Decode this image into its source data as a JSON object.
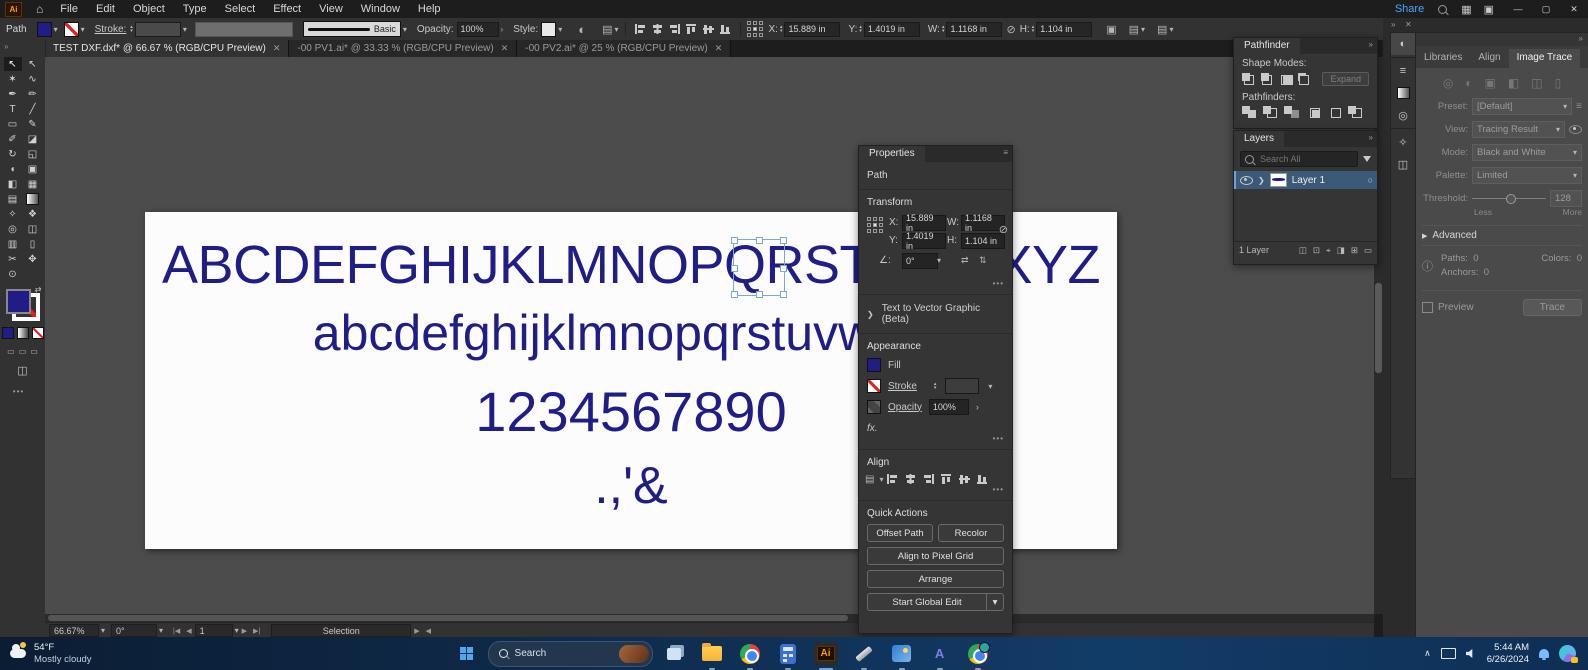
{
  "titlebar": {
    "app_label": "Ai",
    "menus": [
      "File",
      "Edit",
      "Object",
      "Type",
      "Select",
      "Effect",
      "View",
      "Window",
      "Help"
    ],
    "share_label": "Share"
  },
  "control_bar": {
    "selection_type": "Path",
    "stroke_label": "Stroke:",
    "brush_label": "Basic",
    "opacity_label": "Opacity:",
    "opacity_value": "100%",
    "style_label": "Style:",
    "x_label": "X:",
    "x_value": "15.889 in",
    "y_label": "Y:",
    "y_value": "1.4019 in",
    "w_label": "W:",
    "w_value": "1.1168 in",
    "h_label": "H:",
    "h_value": "1.104 in"
  },
  "tabs": [
    {
      "label": "TEST DXF.dxf* @ 66.67 % (RGB/CPU Preview)"
    },
    {
      "label": "-00 PV1.ai* @ 33.33 % (RGB/CPU Preview)"
    },
    {
      "label": "-00 PV2.ai* @ 25 % (RGB/CPU Preview)"
    }
  ],
  "canvas": {
    "line_uppercase": "ABCDEFGHIJKLMNOPQRSTUVWXYZ",
    "line_lowercase": "abcdefghijklmnopqrstuvwxyz",
    "line_numbers": "1234567890",
    "line_symbols": ".,'&",
    "text_color": "#201d86"
  },
  "properties": {
    "tab": "Properties",
    "object_type": "Path",
    "transform": {
      "title": "Transform",
      "x_label": "X:",
      "x_value": "15.889 in",
      "y_label": "Y:",
      "y_value": "1.4019 in",
      "w_label": "W:",
      "w_value": "1.1168 in",
      "h_label": "H:",
      "h_value": "1.104 in",
      "angle_value": "0°"
    },
    "ttvg_label": "Text to Vector Graphic (Beta)",
    "appearance": {
      "title": "Appearance",
      "fill_label": "Fill",
      "stroke_label": "Stroke",
      "opacity_label": "Opacity",
      "opacity_value": "100%",
      "fx_label": "fx."
    },
    "align_title": "Align",
    "quick_actions": {
      "title": "Quick Actions",
      "offset_path": "Offset Path",
      "recolor": "Recolor",
      "align_pixel_grid": "Align to Pixel Grid",
      "arrange": "Arrange",
      "start_global_edit": "Start Global Edit"
    },
    "fill_color": "#201d86"
  },
  "pathfinder": {
    "tab": "Pathfinder",
    "shape_modes_label": "Shape Modes:",
    "expand_label": "Expand",
    "pathfinders_label": "Pathfinders:"
  },
  "layers": {
    "tab": "Layers",
    "search_placeholder": "Search All",
    "layer_name": "Layer 1",
    "count_label": "1 Layer"
  },
  "right_dock": {
    "tabs": [
      "Libraries",
      "Align",
      "Image Trace"
    ],
    "image_trace": {
      "preset_label": "Preset:",
      "preset_value": "[Default]",
      "view_label": "View:",
      "view_value": "Tracing Result",
      "mode_label": "Mode:",
      "mode_value": "Black and White",
      "palette_label": "Palette:",
      "palette_value": "Limited",
      "threshold_label": "Threshold:",
      "threshold_value": "128",
      "less_label": "Less",
      "more_label": "More",
      "advanced_label": "Advanced",
      "paths_label": "Paths:",
      "paths_value": "0",
      "colors_label": "Colors:",
      "colors_value": "0",
      "anchors_label": "Anchors:",
      "anchors_value": "0",
      "preview_label": "Preview",
      "trace_label": "Trace"
    }
  },
  "status_bar": {
    "zoom": "66.67%",
    "rotation": "0°",
    "page": "1",
    "tool": "Selection"
  },
  "taskbar": {
    "weather_temp": "54°F",
    "weather_desc": "Mostly cloudy",
    "search_placeholder": "Search",
    "time": "5:44 AM",
    "date": "6/26/2024"
  },
  "icons": {
    "home": "⌂",
    "caret_down": "▾",
    "caret_up": "▴",
    "caret_right": "›",
    "chevron_right": "❯",
    "collapse": "»",
    "menu": "≡",
    "ellipsis": "•••",
    "minimize": "—",
    "maximize": "▢",
    "close": "✕",
    "workspace": "▦",
    "arrange_docs": "▣",
    "globe": "◐",
    "doc_setup": "▤",
    "selection_tool": "↖",
    "direct_selection_tool": "↖",
    "magic_wand_tool": "✶",
    "lasso_tool": "∿",
    "pen_tool": "✒",
    "curvature_tool": "✏",
    "type_tool": "T",
    "line_tool": "╱",
    "rectangle_tool": "▭",
    "paintbrush_tool": "✎",
    "shaper_tool": "✐",
    "eraser_tool": "◪",
    "rotate_tool": "↻",
    "scale_tool": "◱",
    "width_tool": "◖",
    "free_transform_tool": "▣",
    "shape_builder_tool": "◧",
    "perspective_grid_tool": "▦",
    "mesh_tool": "▤",
    "eyedropper_tool": "✧",
    "blend_tool": "❖",
    "symbol_sprayer_tool": "◎",
    "symbols_tool": "◫",
    "graph_tool": "▥",
    "artboard_tool": "▯",
    "slice_tool": "✂",
    "hand_tool": "✥",
    "zoom_tool": "⊙",
    "swap_colors": "⇄",
    "screen_mode": "◫",
    "angle": "∠:",
    "no_constrain": "⊘",
    "flip_h": "⇄",
    "flip_v": "⇅",
    "info": "ⓘ",
    "advanced_arrow": "▶",
    "target_circle": "○",
    "first_page": "|◀",
    "prev_page": "◀",
    "next_page": "▶",
    "last_page": "▶|",
    "arrow_right_small": "▶",
    "arrow_left_small": "◀",
    "mask_icon": "◫",
    "sublayer_icon": "⊡",
    "locate_icon": "⌖",
    "export_icon": "◨",
    "grid_icon": "▤",
    "new_layer_icon": "⊞",
    "trash_icon": "▭",
    "tray_up": "∧"
  }
}
